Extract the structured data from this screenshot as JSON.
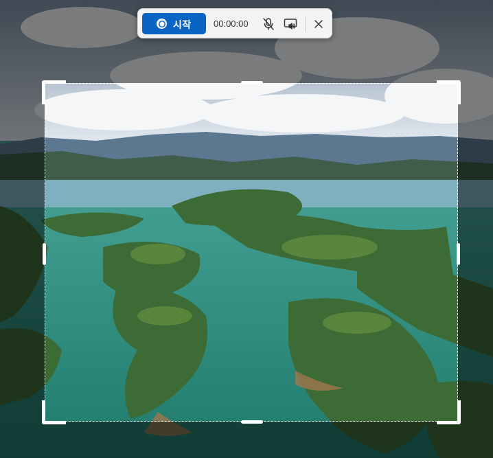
{
  "toolbar": {
    "start_label": "시작",
    "timer": "00:00:00",
    "icons": {
      "record": "record-circle-icon",
      "microphone": "microphone-muted-icon",
      "system_audio": "system-audio-icon",
      "close": "close-icon"
    }
  },
  "colors": {
    "accent": "#0a64c4",
    "toolbar_bg": "#f3f3f3",
    "selection": "#ffffff"
  }
}
